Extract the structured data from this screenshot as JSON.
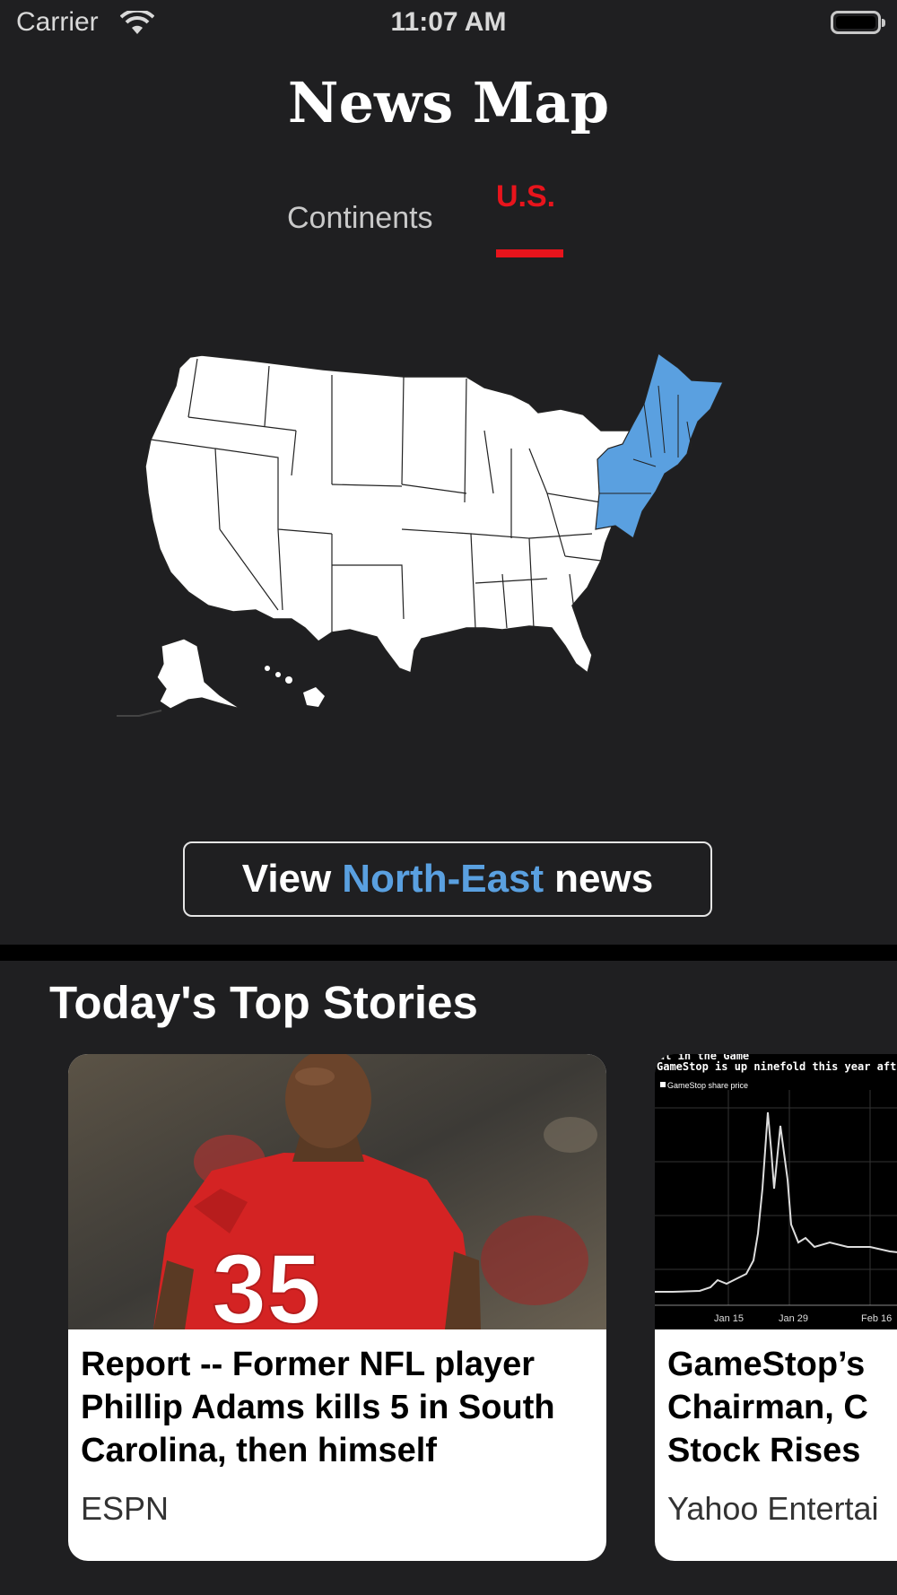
{
  "status_bar": {
    "carrier": "Carrier",
    "time": "11:07 AM"
  },
  "header": {
    "title": "News Map"
  },
  "tabs": [
    {
      "label": "Continents",
      "selected": false
    },
    {
      "label": "U.S.",
      "selected": true
    }
  ],
  "map": {
    "highlighted_region": "North-East",
    "highlight_color": "#5aa0e0",
    "base_color": "#ffffff"
  },
  "view_button": {
    "prefix": "View",
    "region": "North-East",
    "suffix": "news"
  },
  "section": {
    "title": "Today's Top Stories"
  },
  "stories": [
    {
      "headline": "Report -- Former NFL player Phillip Adams kills 5 in South Carolina, then himself",
      "source": "ESPN",
      "image": "football-player-photo"
    },
    {
      "headline_lines": [
        "GameStop’s",
        "Chairman, C",
        "Stock Rises"
      ],
      "source": "Yahoo Entertai",
      "image": "stock-chart",
      "chart_caption_top": "ut in the Game",
      "chart_title": "GameStop is up ninefold this year aft",
      "chart_legend": "GameStop share price",
      "chart_ticks": [
        "Jan 15",
        "Jan 29",
        "Feb 16"
      ]
    }
  ],
  "colors": {
    "accent_red": "#e8141c",
    "accent_blue": "#5aa0e0",
    "background": "#1f1f21"
  }
}
